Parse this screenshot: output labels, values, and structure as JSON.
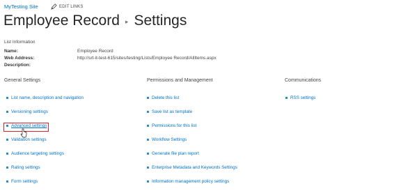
{
  "topbar": {
    "site_name": "MyTesting Site",
    "edit_links": "EDIT LINKS"
  },
  "header": {
    "breadcrumb_parent": "Employee Record",
    "breadcrumb_separator": "▸",
    "title": "Settings"
  },
  "list_info": {
    "heading": "List Information",
    "name_label": "Name:",
    "name_value": "Employee Record",
    "web_address_label": "Web Address:",
    "web_address_value": "http://srt-it-test-615/sites/testing/Lists/Employee Record/AllItems.aspx",
    "description_label": "Description:",
    "description_value": ""
  },
  "general_settings": {
    "heading": "General Settings",
    "items": [
      "List name, description and navigation",
      "Versioning settings",
      "Advanced settings",
      "Validation settings",
      "Audience targeting settings",
      "Rating settings",
      "Form settings"
    ]
  },
  "permissions": {
    "heading": "Permissions and Management",
    "items": [
      "Delete this list",
      "Save list as template",
      "Permissions for this list",
      "Workflow Settings",
      "Generate file plan report",
      "Enterprise Metadata and Keywords Settings",
      "Information management policy settings"
    ]
  },
  "communications": {
    "heading": "Communications",
    "items": [
      "RSS settings"
    ]
  },
  "colors": {
    "link": "#0072c6",
    "bullet": "#2a8dd4",
    "highlight": "#d4242a"
  },
  "icons": {
    "edit": "pencil-icon",
    "pointer": "mouse-cursor-icon"
  }
}
